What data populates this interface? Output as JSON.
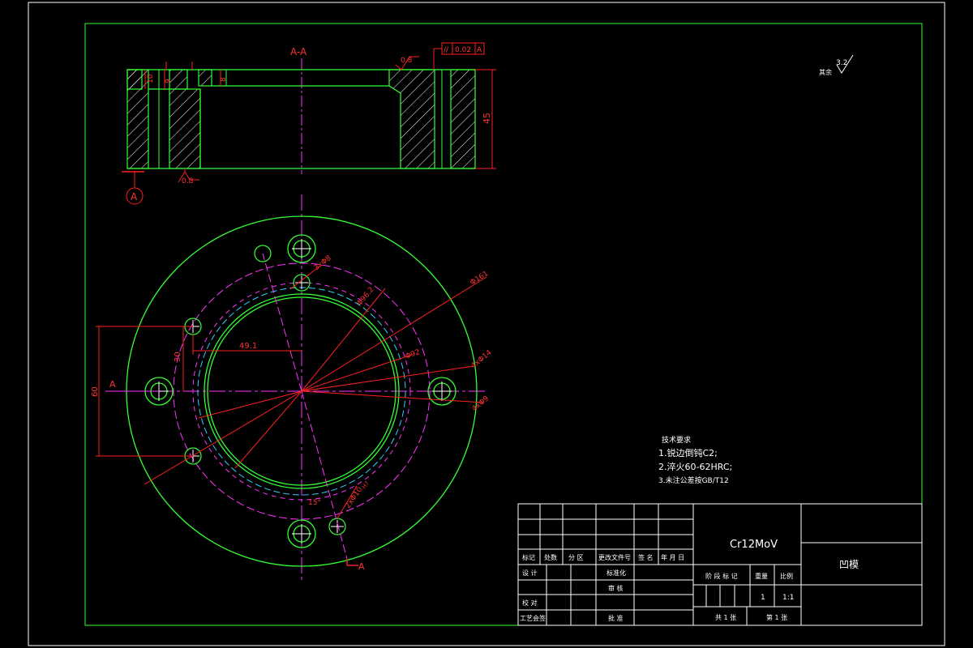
{
  "colors": {
    "background": "#000000",
    "frame": "#ffffff",
    "outline": "#33ff33",
    "dimension": "#ff2020",
    "centerline": "#ff33ff",
    "hidden": "#33ccff",
    "text": "#ffffff",
    "hatch": "#ffffff"
  },
  "section_view": {
    "title": "A-A",
    "dims": {
      "height": "45",
      "d1": "10",
      "d2": "9",
      "d3": "8"
    },
    "roughness_top": "0.8",
    "roughness_bottom": "0.8",
    "tolerance": {
      "symbol": "//",
      "value": "0.02",
      "datum": "A"
    },
    "datum_label": "A"
  },
  "surface_note": {
    "label": "其余",
    "value": "3.2"
  },
  "plan_view": {
    "holes_label_top": "3xΦ8",
    "dia_outer": "Φ161",
    "dia_pitch": "Φ96.2",
    "dia_bore": "Φ92",
    "holes_right_1": "4xΦ14",
    "holes_right_2": "4xΦ9",
    "dim_49": "49.1",
    "dim_30": "30",
    "dim_60": "60",
    "angle": "15°",
    "pin_holes": "2xΦ10",
    "pin_tol": "H7",
    "section_mark": "A"
  },
  "tech_requirements": {
    "title": "技术要求",
    "items": [
      "1.锐边倒钝C2;",
      "2.淬火60-62HRC;",
      "3.未注公差按GB/T12"
    ]
  },
  "title_block": {
    "material": "Cr12MoV",
    "part_name": "凹模",
    "header_labels": [
      "标记",
      "处数",
      "分 区",
      "更改文件号",
      "签 名",
      "年 月 日"
    ],
    "row_design": "设 计",
    "row_standard": "标准化",
    "row_check": "校 对",
    "row_review": "审 核",
    "row_process": "工艺会签",
    "row_approve": "批 准",
    "stage_label": "阶 段 标 记",
    "weight_label": "重量",
    "scale_label": "比例",
    "weight_value": "1",
    "scale_value": "1:1",
    "sheets_total": "共 1 张",
    "sheet_no": "第 1 张"
  }
}
